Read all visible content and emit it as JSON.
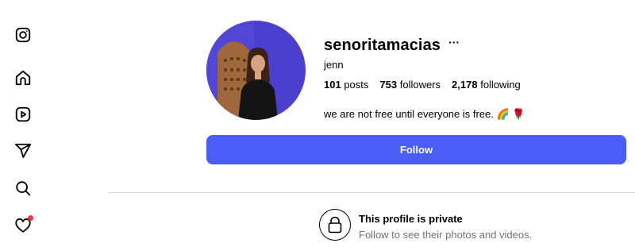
{
  "sidebar": {
    "items": [
      {
        "name": "instagram-icon"
      },
      {
        "name": "home-icon"
      },
      {
        "name": "reels-icon"
      },
      {
        "name": "send-icon"
      },
      {
        "name": "search-icon"
      },
      {
        "name": "heart-icon",
        "notification_dot": true
      }
    ],
    "notification_color": "#ff3040"
  },
  "profile": {
    "username": "senoritamacias",
    "more_label": "···",
    "full_name": "jenn",
    "stats": {
      "posts_count": "101",
      "posts_label": "posts",
      "followers_count": "753",
      "followers_label": "followers",
      "following_count": "2,178",
      "following_label": "following"
    },
    "bio": "we are not free until everyone is free. 🌈 🌹"
  },
  "follow_button": {
    "label": "Follow",
    "color": "#4a5df9"
  },
  "private_notice": {
    "title": "This profile is private",
    "subtitle": "Follow to see their photos and videos."
  }
}
